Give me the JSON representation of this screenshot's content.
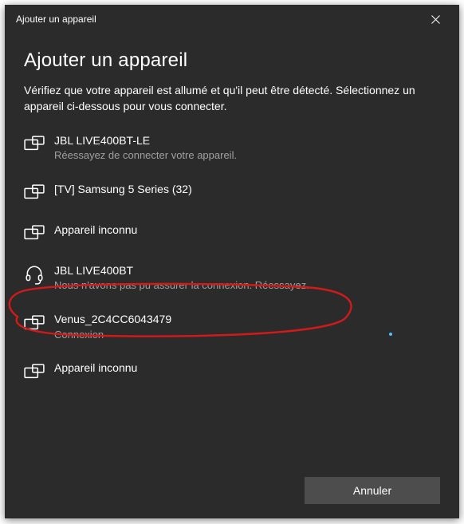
{
  "titlebar": {
    "title": "Ajouter un appareil"
  },
  "heading": "Ajouter un appareil",
  "subtext": "Vérifiez que votre appareil est allumé et qu'il peut être détecté. Sélectionnez un appareil ci-dessous pour vous connecter.",
  "devices": [
    {
      "icon": "screens",
      "name": "JBL LIVE400BT-LE",
      "status": "Réessayez de connecter votre appareil."
    },
    {
      "icon": "screens",
      "name": "[TV] Samsung 5 Series (32)",
      "status": ""
    },
    {
      "icon": "screens",
      "name": "Appareil inconnu",
      "status": ""
    },
    {
      "icon": "headset",
      "name": "JBL LIVE400BT",
      "status": "Nous n'avons pas pu assurer la connexion. Réessayez."
    },
    {
      "icon": "screens",
      "name": "Venus_2C4CC6043479",
      "status": "Connexion"
    },
    {
      "icon": "screens",
      "name": "Appareil inconnu",
      "status": ""
    }
  ],
  "footer": {
    "cancel": "Annuler"
  }
}
